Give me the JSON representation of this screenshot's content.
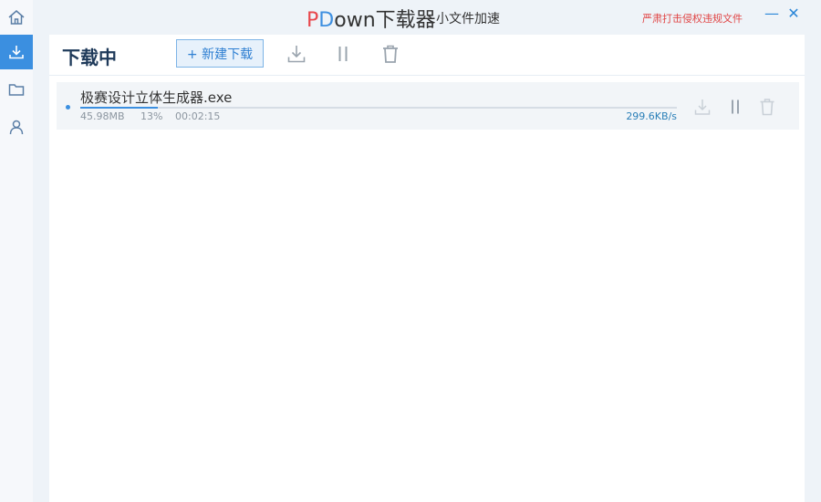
{
  "window": {
    "title_p": "P",
    "title_d": "D",
    "title_rest": "own下载器",
    "subtitle": "小文件加速",
    "notice": "严肃打击侵权违规文件",
    "minimize_glyph": "—",
    "close_glyph": "✕"
  },
  "sidebar": {
    "items": [
      {
        "icon": "home-icon"
      },
      {
        "icon": "download-icon",
        "active": true
      },
      {
        "icon": "folder-icon"
      },
      {
        "icon": "user-icon"
      }
    ]
  },
  "header": {
    "title": "下载中",
    "new_download_label": "+ 新建下载",
    "tools": [
      "download-icon",
      "pause-icon",
      "trash-icon"
    ]
  },
  "tasks": [
    {
      "name": "极赛设计立体生成器.exe",
      "size": "45.98MB",
      "percent": "13%",
      "progress": 0.13,
      "elapsed": "00:02:15",
      "speed": "299.6KB/s"
    }
  ],
  "colors": {
    "accent": "#3b8fe0",
    "notice": "#e04545",
    "brand_p": "#e8474c",
    "brand_d": "#3d8fe0"
  }
}
